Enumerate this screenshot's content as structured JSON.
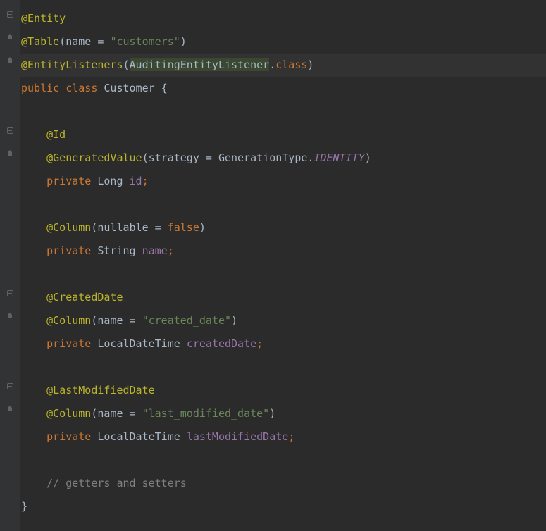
{
  "code": {
    "line1": {
      "annotation": "@Entity"
    },
    "line2": {
      "annotation": "@Table",
      "lparen": "(",
      "param": "name",
      "eq": " = ",
      "value": "\"customers\"",
      "rparen": ")"
    },
    "line3": {
      "annotation": "@EntityListeners",
      "lparen": "(",
      "identifier": "AuditingEntityListener",
      "dot": ".",
      "class_kw": "class",
      "rparen": ")"
    },
    "line4": {
      "public_kw": "public ",
      "class_kw": "class ",
      "classname": "Customer ",
      "brace": "{"
    },
    "line5": "",
    "line6": {
      "indent": "    ",
      "annotation": "@Id"
    },
    "line7": {
      "indent": "    ",
      "annotation": "@GeneratedValue",
      "lparen": "(",
      "param": "strategy",
      "eq": " = ",
      "type": "GenerationType",
      "dot": ".",
      "constant": "IDENTITY",
      "rparen": ")"
    },
    "line8": {
      "indent": "    ",
      "private_kw": "private ",
      "type": "Long ",
      "field": "id",
      "semi": ";"
    },
    "line9": "",
    "line10": {
      "indent": "    ",
      "annotation": "@Column",
      "lparen": "(",
      "param": "nullable",
      "eq": " = ",
      "value": "false",
      "rparen": ")"
    },
    "line11": {
      "indent": "    ",
      "private_kw": "private ",
      "type": "String ",
      "field": "name",
      "semi": ";"
    },
    "line12": "",
    "line13": {
      "indent": "    ",
      "annotation": "@CreatedDate"
    },
    "line14": {
      "indent": "    ",
      "annotation": "@Column",
      "lparen": "(",
      "param": "name",
      "eq": " = ",
      "value": "\"created_date\"",
      "rparen": ")"
    },
    "line15": {
      "indent": "    ",
      "private_kw": "private ",
      "type": "LocalDateTime ",
      "field": "createdDate",
      "semi": ";"
    },
    "line16": "",
    "line17": {
      "indent": "    ",
      "annotation": "@LastModifiedDate"
    },
    "line18": {
      "indent": "    ",
      "annotation": "@Column",
      "lparen": "(",
      "param": "name",
      "eq": " = ",
      "value": "\"last_modified_date\"",
      "rparen": ")"
    },
    "line19": {
      "indent": "    ",
      "private_kw": "private ",
      "type": "LocalDateTime ",
      "field": "lastModifiedDate",
      "semi": ";"
    },
    "line20": "",
    "line21": {
      "indent": "    ",
      "comment": "// getters and setters"
    },
    "line22": {
      "brace": "}"
    }
  },
  "gutter_markers": [
    {
      "line": 1,
      "type": "minus"
    },
    {
      "line": 2,
      "type": "house"
    },
    {
      "line": 3,
      "type": "house"
    },
    {
      "line": 6,
      "type": "minus"
    },
    {
      "line": 7,
      "type": "house"
    },
    {
      "line": 13,
      "type": "minus"
    },
    {
      "line": 14,
      "type": "house"
    },
    {
      "line": 17,
      "type": "minus"
    },
    {
      "line": 18,
      "type": "house"
    }
  ]
}
